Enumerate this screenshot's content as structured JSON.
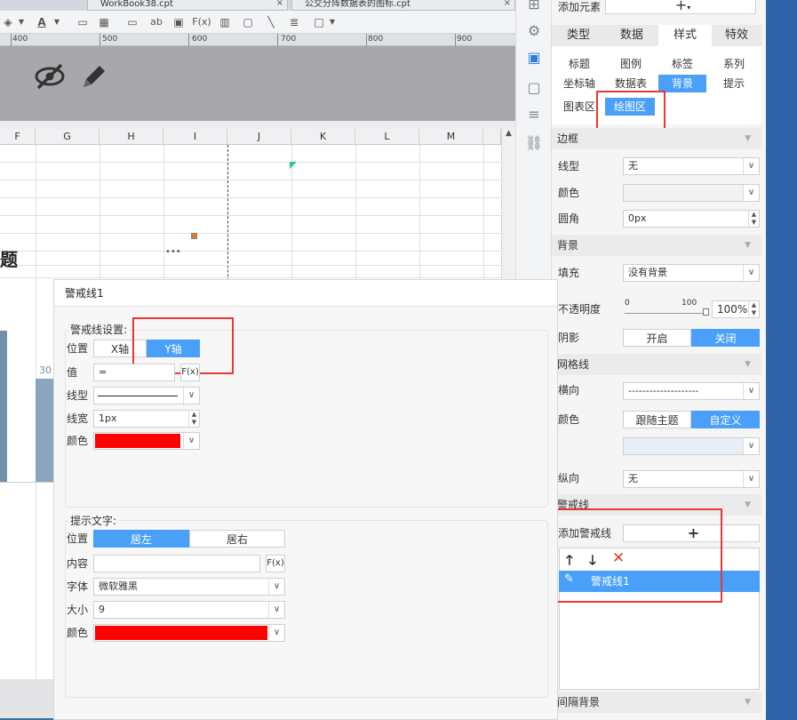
{
  "colors": {
    "accent": "#4aa0f8",
    "highlight": "#e53935",
    "red_swatch": "#ff0000",
    "desktop": "#3a6ea5"
  },
  "editor": {
    "tabs": [
      {
        "label": "WorkBook38.cpt",
        "close": "×"
      },
      {
        "label": "公交分阵数据表的图标.cpt",
        "close": "×"
      }
    ],
    "ruler_labels": [
      "400",
      "500",
      "600",
      "700",
      "800",
      "900"
    ],
    "columns": [
      "F",
      "G",
      "H",
      "I",
      "J",
      "K",
      "L",
      "M"
    ],
    "cell_title_fragment": "题",
    "ellipsis": "•••",
    "chart_value": "30"
  },
  "panel": {
    "add_element_label": "添加元素",
    "add_symbol": "+",
    "main_tabs": [
      "类型",
      "数据",
      "样式",
      "特效"
    ],
    "main_active": "样式",
    "sub_row1": [
      "标题",
      "图例",
      "标签",
      "系列"
    ],
    "sub_row2": [
      "坐标轴",
      "数据表",
      "背景",
      "提示"
    ],
    "sub_row3": [
      "图表区",
      "绘图区"
    ],
    "border_section": "边框",
    "line_type_label": "线型",
    "line_type_value": "无",
    "color_label": "颜色",
    "corner_label": "圆角",
    "corner_value": "0px",
    "background_section": "背景",
    "fill_label": "填充",
    "fill_value": "没有背景",
    "opacity_label": "不透明度",
    "opacity_min": "0",
    "opacity_max": "100",
    "opacity_value": "100%",
    "opacity_level": 1.0,
    "shadow_label": "阴影",
    "shadow_on": "开启",
    "shadow_off": "关闭",
    "grid_section": "网格线",
    "horizontal_label": "横向",
    "horizontal_value": "--------------------",
    "grid_color_label": "颜色",
    "grid_color_follow": "跟随主题",
    "grid_color_custom": "自定义",
    "vertical_label": "纵向",
    "vertical_value": "无",
    "warning_section": "警戒线",
    "add_warning_label": "添加警戒线",
    "warning_item": "警戒线1",
    "interval_bg_section": "间隔背景"
  },
  "dialog": {
    "title": "警戒线1",
    "settings_label": "警戒线设置:",
    "position_label": "位置",
    "x_axis": "X轴",
    "y_axis": "Y轴",
    "value_label": "值",
    "value_text": "=",
    "fx": "F(x)",
    "linetype_label": "线型",
    "linewidth_label": "线宽",
    "linewidth_value": "1px",
    "color_label": "颜色",
    "hint_label": "提示文字:",
    "hint_position_label": "位置",
    "hint_left": "居左",
    "hint_right": "居右",
    "content_label": "内容",
    "font_label": "字体",
    "font_value": "微软雅黑",
    "size_label": "大小",
    "size_value": "9",
    "hint_color_label": "颜色"
  }
}
